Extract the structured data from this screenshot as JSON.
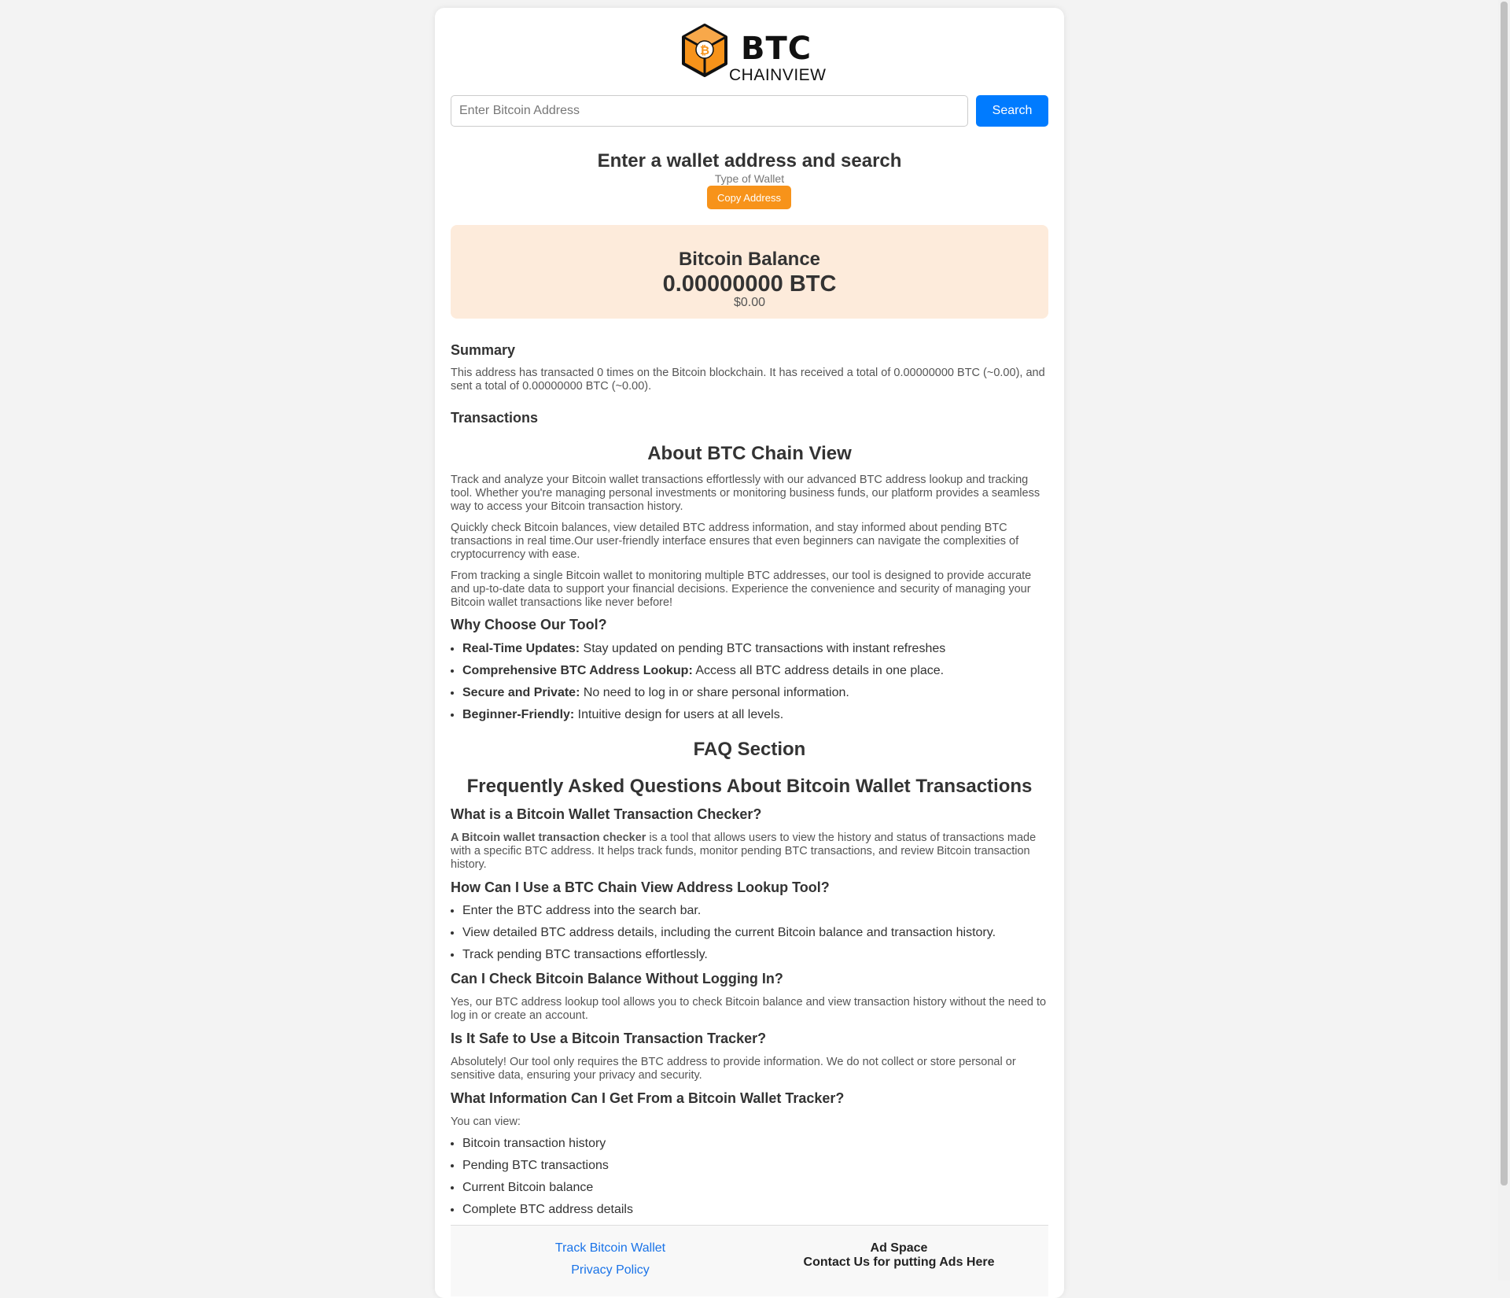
{
  "brand": {
    "name": "BTC",
    "sub": "CHAINVIEW",
    "colors": {
      "orange": "#f7931a",
      "dark": "#111111"
    },
    "icon": "bitcoin-hexagon-logo"
  },
  "search": {
    "placeholder": "Enter Bitcoin Address",
    "button": "Search"
  },
  "wallet": {
    "heading": "Enter a wallet address and search",
    "type": "Type of Wallet",
    "copy_button": "Copy Address"
  },
  "balance": {
    "title": "Bitcoin Balance",
    "btc": "0.00000000 BTC",
    "usd": "$0.00"
  },
  "summary": {
    "heading": "Summary",
    "text": "This address has transacted 0 times on the Bitcoin blockchain. It has received a total of 0.00000000 BTC (~0.00), and sent a total of 0.00000000 BTC (~0.00)."
  },
  "transactions": {
    "heading": "Transactions"
  },
  "about": {
    "heading": "About BTC Chain View",
    "p1": "Track and analyze your Bitcoin wallet transactions effortlessly with our advanced BTC address lookup and tracking tool. Whether you're managing personal investments or monitoring business funds, our platform provides a seamless way to access your Bitcoin transaction history.",
    "p2": "Quickly check Bitcoin balances, view detailed BTC address information, and stay informed about pending BTC transactions in real time.Our user-friendly interface ensures that even beginners can navigate the complexities of cryptocurrency with ease.",
    "p3": "From tracking a single Bitcoin wallet to monitoring multiple BTC addresses, our tool is designed to provide accurate and up-to-date data to support your financial decisions. Experience the convenience and security of managing your Bitcoin wallet transactions like never before!",
    "why_heading": "Why Choose Our Tool?",
    "why": [
      {
        "bold": "Real-Time Updates:",
        "text": " Stay updated on pending BTC transactions with instant refreshes"
      },
      {
        "bold": "Comprehensive BTC Address Lookup:",
        "text": " Access all BTC address details in one place."
      },
      {
        "bold": "Secure and Private:",
        "text": " No need to log in or share personal information."
      },
      {
        "bold": "Beginner-Friendly:",
        "text": " Intuitive design for users at all levels."
      }
    ]
  },
  "faq": {
    "section": "FAQ Section",
    "title": "Frequently Asked Questions About Bitcoin Wallet Transactions",
    "q1": "What is a Bitcoin Wallet Transaction Checker?",
    "a1_bold": "A Bitcoin wallet transaction checker",
    "a1_text": " is a tool that allows users to view the history and status of transactions made with a specific BTC address. It helps track funds, monitor pending BTC transactions, and review Bitcoin transaction history.",
    "q2": "How Can I Use a BTC Chain View Address Lookup Tool?",
    "a2": [
      "Enter the BTC address into the search bar.",
      "View detailed BTC address details, including the current Bitcoin balance and transaction history.",
      "Track pending BTC transactions effortlessly."
    ],
    "q3": "Can I Check Bitcoin Balance Without Logging In?",
    "a3": "Yes, our BTC address lookup tool allows you to check Bitcoin balance and view transaction history without the need to log in or create an account.",
    "q4": "Is It Safe to Use a Bitcoin Transaction Tracker?",
    "a4": "Absolutely! Our tool only requires the BTC address to provide information. We do not collect or store personal or sensitive data, ensuring your privacy and security.",
    "q5": "What Information Can I Get From a Bitcoin Wallet Tracker?",
    "a5_intro": "You can view:",
    "a5": [
      "Bitcoin transaction history",
      "Pending BTC transactions",
      "Current Bitcoin balance",
      "Complete BTC address details"
    ]
  },
  "footer": {
    "links": [
      "Track Bitcoin Wallet",
      "Privacy Policy"
    ],
    "ad_title": "Ad Space",
    "ad_text": "Contact Us for putting Ads Here"
  }
}
